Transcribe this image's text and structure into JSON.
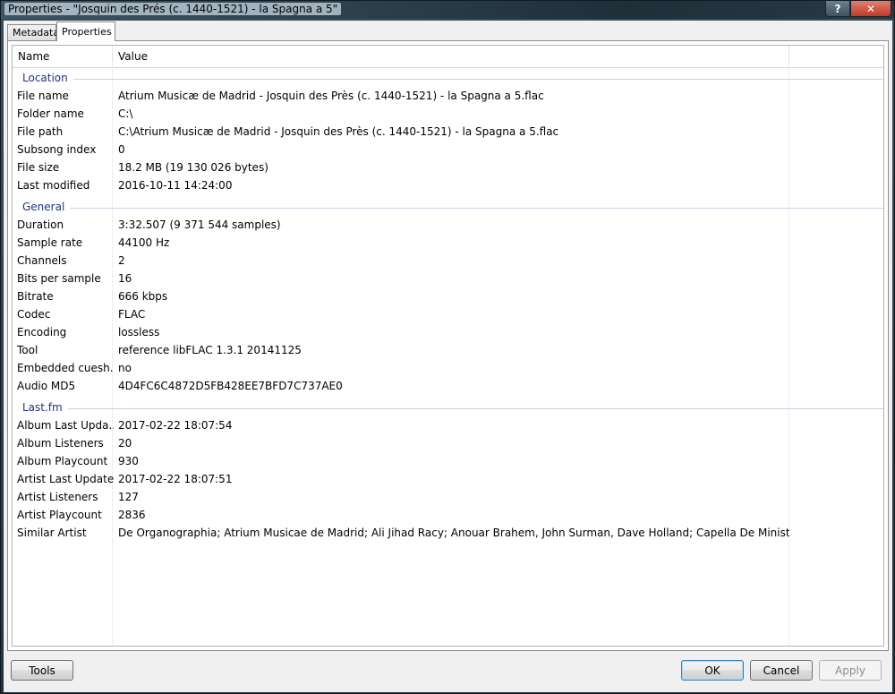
{
  "window": {
    "title": "Properties - \"Josquin des Prés (c. 1440-1521) - la Spagna a 5\"",
    "help_label": "?",
    "close_label": "✕"
  },
  "tabs": [
    {
      "label": "Metadata",
      "active": false
    },
    {
      "label": "Properties",
      "active": true
    }
  ],
  "columns": {
    "name": "Name",
    "value": "Value"
  },
  "groups": [
    {
      "label": "Location",
      "rows": [
        {
          "name": "File name",
          "value": "Atrium Musicæ de Madrid - Josquin des Près (c. 1440-1521) - la Spagna a 5.flac"
        },
        {
          "name": "Folder name",
          "value": "C:\\"
        },
        {
          "name": "File path",
          "value": "C:\\Atrium Musicæ de Madrid - Josquin des Près (c. 1440-1521) - la Spagna a 5.flac"
        },
        {
          "name": "Subsong index",
          "value": "0"
        },
        {
          "name": "File size",
          "value": "18.2 MB (19 130 026 bytes)"
        },
        {
          "name": "Last modified",
          "value": "2016-10-11 14:24:00"
        }
      ]
    },
    {
      "label": "General",
      "rows": [
        {
          "name": "Duration",
          "value": "3:32.507 (9 371 544 samples)"
        },
        {
          "name": "Sample rate",
          "value": "44100 Hz"
        },
        {
          "name": "Channels",
          "value": "2"
        },
        {
          "name": "Bits per sample",
          "value": "16"
        },
        {
          "name": "Bitrate",
          "value": "666 kbps"
        },
        {
          "name": "Codec",
          "value": "FLAC"
        },
        {
          "name": "Encoding",
          "value": "lossless"
        },
        {
          "name": "Tool",
          "value": "reference libFLAC 1.3.1 20141125"
        },
        {
          "name": "Embedded cuesh...",
          "value": "no"
        },
        {
          "name": "Audio MD5",
          "value": "4D4FC6C4872D5FB428EE7BFD7C737AE0"
        }
      ]
    },
    {
      "label": "Last.fm",
      "rows": [
        {
          "name": "Album Last Upda...",
          "value": "2017-02-22 18:07:54"
        },
        {
          "name": "Album Listeners",
          "value": "20"
        },
        {
          "name": "Album Playcount",
          "value": "930"
        },
        {
          "name": "Artist Last Updated",
          "value": "2017-02-22 18:07:51"
        },
        {
          "name": "Artist Listeners",
          "value": "127"
        },
        {
          "name": "Artist Playcount",
          "value": "2836"
        },
        {
          "name": "Similar Artist",
          "value": "De Organographia; Atrium Musicae de Madrid; Ali Jihad Racy; Anouar Brahem, John Surman, Dave Holland; Capella De Ministrers"
        }
      ]
    }
  ],
  "buttons": {
    "tools": "Tools",
    "ok": "OK",
    "cancel": "Cancel",
    "apply": "Apply"
  },
  "colors": {
    "group_label": "#1e3287",
    "group_line": "#c6d3e1"
  }
}
